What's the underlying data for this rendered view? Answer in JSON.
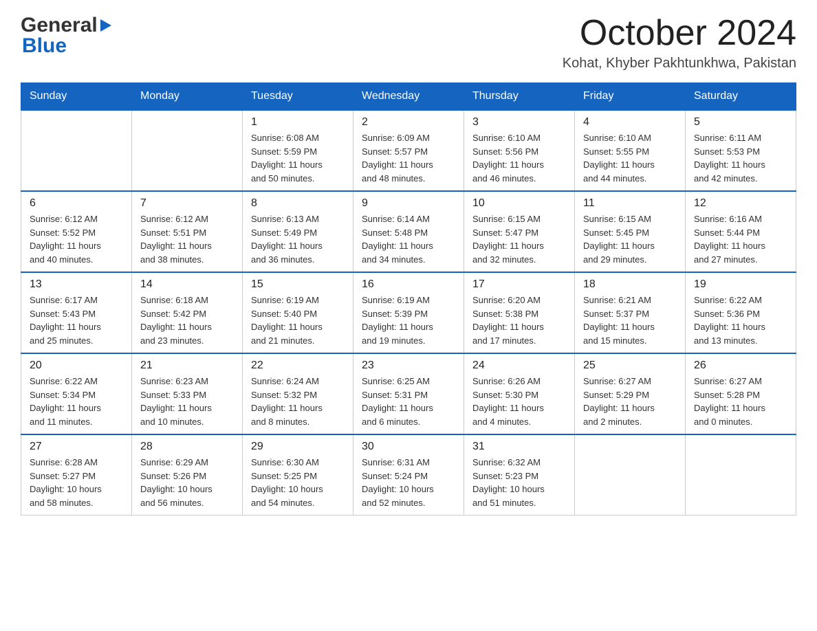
{
  "header": {
    "logo_general": "General",
    "logo_blue": "Blue",
    "month_title": "October 2024",
    "location": "Kohat, Khyber Pakhtunkhwa, Pakistan"
  },
  "days_of_week": [
    "Sunday",
    "Monday",
    "Tuesday",
    "Wednesday",
    "Thursday",
    "Friday",
    "Saturday"
  ],
  "weeks": [
    [
      {
        "day": "",
        "info": ""
      },
      {
        "day": "",
        "info": ""
      },
      {
        "day": "1",
        "info": "Sunrise: 6:08 AM\nSunset: 5:59 PM\nDaylight: 11 hours\nand 50 minutes."
      },
      {
        "day": "2",
        "info": "Sunrise: 6:09 AM\nSunset: 5:57 PM\nDaylight: 11 hours\nand 48 minutes."
      },
      {
        "day": "3",
        "info": "Sunrise: 6:10 AM\nSunset: 5:56 PM\nDaylight: 11 hours\nand 46 minutes."
      },
      {
        "day": "4",
        "info": "Sunrise: 6:10 AM\nSunset: 5:55 PM\nDaylight: 11 hours\nand 44 minutes."
      },
      {
        "day": "5",
        "info": "Sunrise: 6:11 AM\nSunset: 5:53 PM\nDaylight: 11 hours\nand 42 minutes."
      }
    ],
    [
      {
        "day": "6",
        "info": "Sunrise: 6:12 AM\nSunset: 5:52 PM\nDaylight: 11 hours\nand 40 minutes."
      },
      {
        "day": "7",
        "info": "Sunrise: 6:12 AM\nSunset: 5:51 PM\nDaylight: 11 hours\nand 38 minutes."
      },
      {
        "day": "8",
        "info": "Sunrise: 6:13 AM\nSunset: 5:49 PM\nDaylight: 11 hours\nand 36 minutes."
      },
      {
        "day": "9",
        "info": "Sunrise: 6:14 AM\nSunset: 5:48 PM\nDaylight: 11 hours\nand 34 minutes."
      },
      {
        "day": "10",
        "info": "Sunrise: 6:15 AM\nSunset: 5:47 PM\nDaylight: 11 hours\nand 32 minutes."
      },
      {
        "day": "11",
        "info": "Sunrise: 6:15 AM\nSunset: 5:45 PM\nDaylight: 11 hours\nand 29 minutes."
      },
      {
        "day": "12",
        "info": "Sunrise: 6:16 AM\nSunset: 5:44 PM\nDaylight: 11 hours\nand 27 minutes."
      }
    ],
    [
      {
        "day": "13",
        "info": "Sunrise: 6:17 AM\nSunset: 5:43 PM\nDaylight: 11 hours\nand 25 minutes."
      },
      {
        "day": "14",
        "info": "Sunrise: 6:18 AM\nSunset: 5:42 PM\nDaylight: 11 hours\nand 23 minutes."
      },
      {
        "day": "15",
        "info": "Sunrise: 6:19 AM\nSunset: 5:40 PM\nDaylight: 11 hours\nand 21 minutes."
      },
      {
        "day": "16",
        "info": "Sunrise: 6:19 AM\nSunset: 5:39 PM\nDaylight: 11 hours\nand 19 minutes."
      },
      {
        "day": "17",
        "info": "Sunrise: 6:20 AM\nSunset: 5:38 PM\nDaylight: 11 hours\nand 17 minutes."
      },
      {
        "day": "18",
        "info": "Sunrise: 6:21 AM\nSunset: 5:37 PM\nDaylight: 11 hours\nand 15 minutes."
      },
      {
        "day": "19",
        "info": "Sunrise: 6:22 AM\nSunset: 5:36 PM\nDaylight: 11 hours\nand 13 minutes."
      }
    ],
    [
      {
        "day": "20",
        "info": "Sunrise: 6:22 AM\nSunset: 5:34 PM\nDaylight: 11 hours\nand 11 minutes."
      },
      {
        "day": "21",
        "info": "Sunrise: 6:23 AM\nSunset: 5:33 PM\nDaylight: 11 hours\nand 10 minutes."
      },
      {
        "day": "22",
        "info": "Sunrise: 6:24 AM\nSunset: 5:32 PM\nDaylight: 11 hours\nand 8 minutes."
      },
      {
        "day": "23",
        "info": "Sunrise: 6:25 AM\nSunset: 5:31 PM\nDaylight: 11 hours\nand 6 minutes."
      },
      {
        "day": "24",
        "info": "Sunrise: 6:26 AM\nSunset: 5:30 PM\nDaylight: 11 hours\nand 4 minutes."
      },
      {
        "day": "25",
        "info": "Sunrise: 6:27 AM\nSunset: 5:29 PM\nDaylight: 11 hours\nand 2 minutes."
      },
      {
        "day": "26",
        "info": "Sunrise: 6:27 AM\nSunset: 5:28 PM\nDaylight: 11 hours\nand 0 minutes."
      }
    ],
    [
      {
        "day": "27",
        "info": "Sunrise: 6:28 AM\nSunset: 5:27 PM\nDaylight: 10 hours\nand 58 minutes."
      },
      {
        "day": "28",
        "info": "Sunrise: 6:29 AM\nSunset: 5:26 PM\nDaylight: 10 hours\nand 56 minutes."
      },
      {
        "day": "29",
        "info": "Sunrise: 6:30 AM\nSunset: 5:25 PM\nDaylight: 10 hours\nand 54 minutes."
      },
      {
        "day": "30",
        "info": "Sunrise: 6:31 AM\nSunset: 5:24 PM\nDaylight: 10 hours\nand 52 minutes."
      },
      {
        "day": "31",
        "info": "Sunrise: 6:32 AM\nSunset: 5:23 PM\nDaylight: 10 hours\nand 51 minutes."
      },
      {
        "day": "",
        "info": ""
      },
      {
        "day": "",
        "info": ""
      }
    ]
  ]
}
